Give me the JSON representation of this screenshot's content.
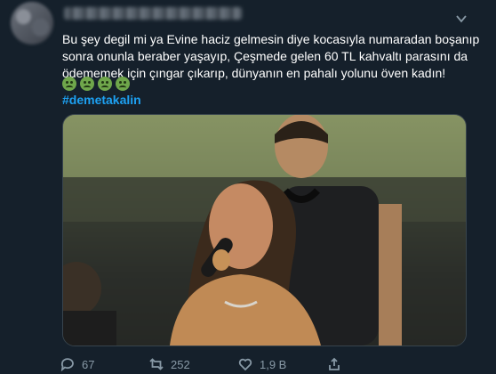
{
  "tweet": {
    "text_lines": [
      "Bu şey degil mi ya Evine haciz gelmesin diye kocasıyla numaradan boşanıp",
      "sonra onunla beraber yaşayıp, Çeşmede gelen 60 TL kahvaltı parasını  da",
      "ödememek için çıngar çıkarıp, dünyanın en pahalı yolunu öven kadın!"
    ],
    "emojis": [
      "nauseated-face",
      "nauseated-face",
      "nauseated-face",
      "nauseated-face"
    ],
    "hashtag": "#demetakalin"
  },
  "actions": {
    "reply_count": "67",
    "retweet_count": "252",
    "like_count": "1,9 B"
  },
  "colors": {
    "background": "#15202b",
    "text": "#ffffff",
    "link": "#1da1f2",
    "muted": "#8899a6"
  }
}
